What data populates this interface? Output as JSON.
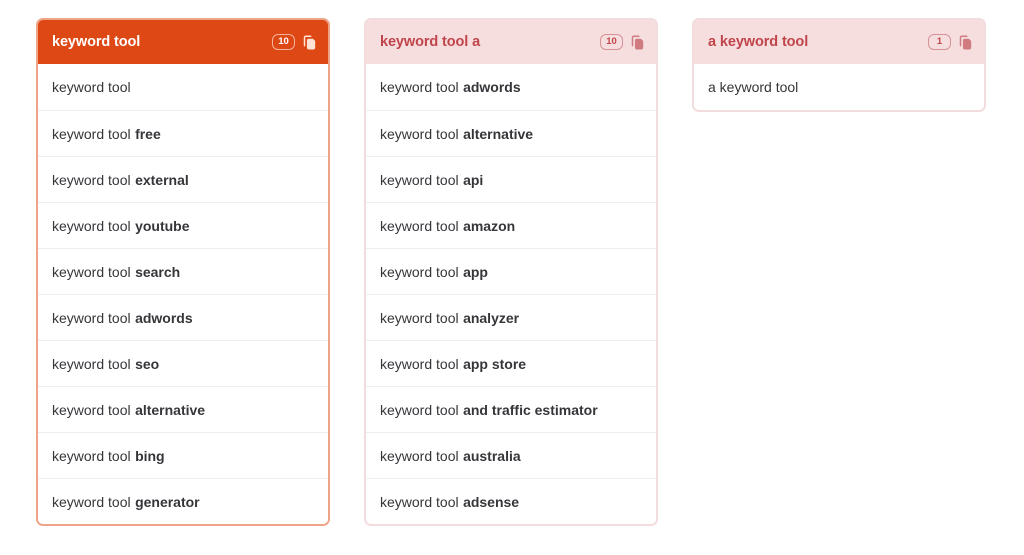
{
  "colors": {
    "active_header_bg": "#dd4814",
    "active_header_text": "#ffffff",
    "active_border": "#eda487",
    "muted_header_bg": "#f6dedf",
    "muted_header_text": "#c0454b",
    "muted_border": "#f3dcdd",
    "row_text": "#35363a",
    "row_divider": "#eeeeee",
    "page_bg": "#ffffff"
  },
  "icons": {
    "copy": "copy-icon"
  },
  "cards": [
    {
      "title": "keyword tool",
      "count": "10",
      "state": "active",
      "copy_icon": "copy-icon",
      "rows": [
        {
          "base": "keyword tool",
          "suffix": ""
        },
        {
          "base": "keyword tool",
          "suffix": "free"
        },
        {
          "base": "keyword tool",
          "suffix": "external"
        },
        {
          "base": "keyword tool",
          "suffix": "youtube"
        },
        {
          "base": "keyword tool",
          "suffix": "search"
        },
        {
          "base": "keyword tool",
          "suffix": "adwords"
        },
        {
          "base": "keyword tool",
          "suffix": "seo"
        },
        {
          "base": "keyword tool",
          "suffix": "alternative"
        },
        {
          "base": "keyword tool",
          "suffix": "bing"
        },
        {
          "base": "keyword tool",
          "suffix": "generator"
        }
      ]
    },
    {
      "title": "keyword tool a",
      "count": "10",
      "state": "muted",
      "copy_icon": "copy-icon",
      "rows": [
        {
          "base": "keyword tool",
          "suffix": "adwords"
        },
        {
          "base": "keyword tool",
          "suffix": "alternative"
        },
        {
          "base": "keyword tool",
          "suffix": "api"
        },
        {
          "base": "keyword tool",
          "suffix": "amazon"
        },
        {
          "base": "keyword tool",
          "suffix": "app"
        },
        {
          "base": "keyword tool",
          "suffix": "analyzer"
        },
        {
          "base": "keyword tool",
          "suffix": "app store"
        },
        {
          "base": "keyword tool",
          "suffix": "and traffic estimator"
        },
        {
          "base": "keyword tool",
          "suffix": "australia"
        },
        {
          "base": "keyword tool",
          "suffix": "adsense"
        }
      ]
    },
    {
      "title": "a keyword tool",
      "count": "1",
      "state": "muted",
      "copy_icon": "copy-icon",
      "rows": [
        {
          "base": "a keyword tool",
          "suffix": ""
        }
      ]
    }
  ]
}
